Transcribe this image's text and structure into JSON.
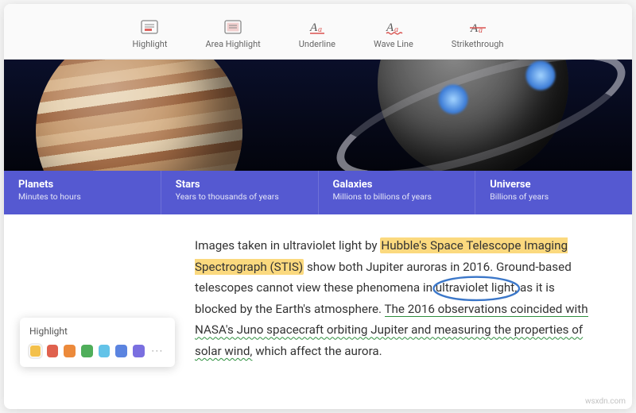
{
  "toolbar": {
    "highlight": "Highlight",
    "area_highlight": "Area Highlight",
    "underline": "Underline",
    "wave_line": "Wave Line",
    "strikethrough": "Strikethrough"
  },
  "band": [
    {
      "title": "Planets",
      "sub": "Minutes to hours"
    },
    {
      "title": "Stars",
      "sub": "Years to thousands of years"
    },
    {
      "title": "Galaxies",
      "sub": "Millions to billions of years"
    },
    {
      "title": "Universe",
      "sub": "Billions of years"
    }
  ],
  "article": {
    "t1": "Images taken in ultraviolet light by ",
    "hl": "Hubble's Space Telescope Imaging Spectrograph (STIS)",
    "t2": " show both Jupiter auroras in 2016. Ground-based telescopes cannot view these phenomena in ",
    "ring": "ultraviolet light,",
    "t3": " as it is blocked by  the Earth's atmosphere. ",
    "ul": "The 2016 observations coincided with",
    "t4": " ",
    "wavy": "NASA's Juno  spacecraft orbiting Jupiter and measuring the properties of solar wind,",
    "t5": " which affect the aurora."
  },
  "palette": {
    "title": "Highlight",
    "colors": [
      "#f3c04b",
      "#e0614e",
      "#ec8a3b",
      "#4fae5a",
      "#63c3e8",
      "#5b84e0",
      "#7a6fe0"
    ],
    "selected_index": 0,
    "more": "···"
  },
  "watermark": "wsxdn.com"
}
